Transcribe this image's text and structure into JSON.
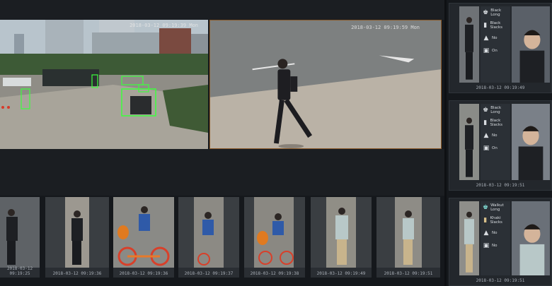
{
  "cameras": {
    "city": {
      "timestamp": "2018-03-12 09:19:39 Mon"
    },
    "walker": {
      "timestamp": "2018-03-12 09:19:59 Mon"
    }
  },
  "strip": [
    {
      "timestamp": "2018-03-12 09:19:25"
    },
    {
      "timestamp": "2018-03-12 09:19:36"
    },
    {
      "timestamp": "2018-03-12 09:19:36"
    },
    {
      "timestamp": "2018-03-12 09:19:37"
    },
    {
      "timestamp": "2018-03-12 09:19:38"
    },
    {
      "timestamp": "2018-03-12 09:19:49"
    },
    {
      "timestamp": "2018-03-12 09:19:51"
    }
  ],
  "id_cards": [
    {
      "timestamp": "2018-03-12 09:19:49",
      "attributes": [
        {
          "icon": "coat-icon",
          "glyph": "♚",
          "text": "Black Long"
        },
        {
          "icon": "pants-icon",
          "glyph": "▮",
          "text": "Black Slacks"
        },
        {
          "icon": "hat-icon",
          "glyph": "▲",
          "text": "No"
        },
        {
          "icon": "bag-icon",
          "glyph": "▣",
          "text": "On"
        }
      ]
    },
    {
      "timestamp": "2018-03-12 09:19:51",
      "attributes": [
        {
          "icon": "coat-icon",
          "glyph": "♚",
          "text": "Black Long"
        },
        {
          "icon": "pants-icon",
          "glyph": "▮",
          "text": "Black Slacks"
        },
        {
          "icon": "hat-icon",
          "glyph": "▲",
          "text": "No"
        },
        {
          "icon": "bag-icon",
          "glyph": "▣",
          "text": "On"
        }
      ]
    },
    {
      "timestamp": "2018-03-12 09:19:51",
      "attributes": [
        {
          "icon": "coat-icon",
          "glyph": "♚",
          "text": "Walkut Long"
        },
        {
          "icon": "pants-icon",
          "glyph": "▮",
          "text": "Khaki Slacks"
        },
        {
          "icon": "hat-icon",
          "glyph": "▲",
          "text": "No"
        },
        {
          "icon": "bag-icon",
          "glyph": "▣",
          "text": "No"
        }
      ]
    }
  ],
  "colors": {
    "detection_box": "#3cff3c",
    "selected_border": "#8a5a2a",
    "background": "#15181c"
  }
}
